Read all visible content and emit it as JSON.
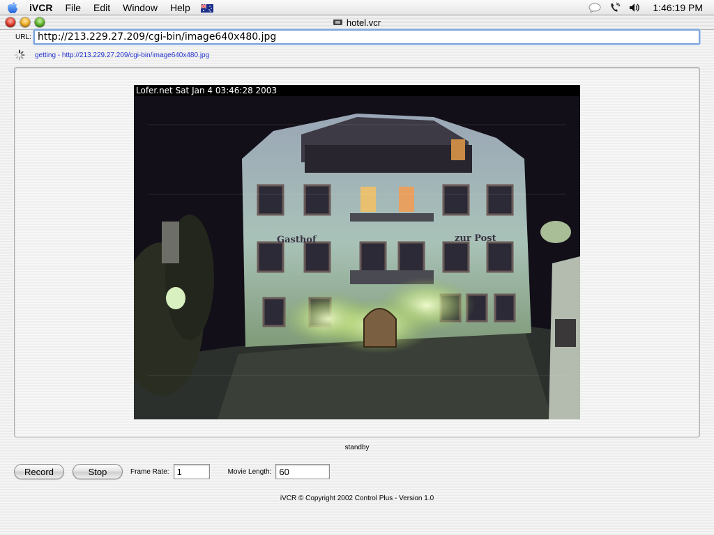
{
  "menubar": {
    "app_name": "iVCR",
    "menus": [
      "File",
      "Edit",
      "Window",
      "Help"
    ],
    "clock": "1:46:19 PM"
  },
  "window": {
    "title": "hotel.vcr"
  },
  "url_bar": {
    "label": "URL:",
    "value": "http://213.229.27.209/cgi-bin/image640x480.jpg"
  },
  "status": {
    "text": "getting - http://213.229.27.209/cgi-bin/image640x480.jpg",
    "color": "#2233cc"
  },
  "camera": {
    "caption": "Lofer.net  Sat Jan  4  03:46:28  2003",
    "sign_left": "Gasthof",
    "sign_right": "zur Post"
  },
  "player_state": "standby",
  "controls": {
    "record_label": "Record",
    "stop_label": "Stop",
    "frame_rate_label": "Frame Rate:",
    "frame_rate_value": "1",
    "movie_length_label": "Movie Length:",
    "movie_length_value": "60"
  },
  "footer": {
    "copyright": "iVCR © Copyright 2002 Control Plus - Version 1.0"
  }
}
